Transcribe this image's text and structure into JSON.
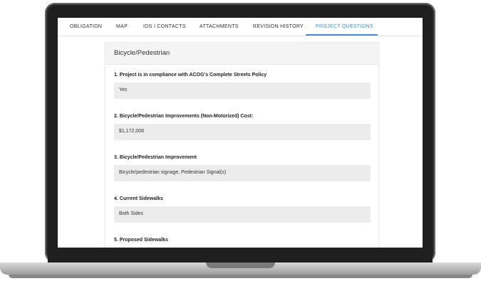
{
  "tabs": [
    {
      "label": "OBLIGATION"
    },
    {
      "label": "MAP"
    },
    {
      "label": "IDS / CONTACTS"
    },
    {
      "label": "ATTACHMENTS"
    },
    {
      "label": "REVISION HISTORY"
    },
    {
      "label": "PROJECT QUESTIONS",
      "active": true
    }
  ],
  "section": {
    "title": "Bicycle/Pedestrian",
    "questions": [
      {
        "label": "1. Project is in compliance with ACOG's Complete Streets Policy",
        "answer": "Yes"
      },
      {
        "label": "2. Bicycle/Pedestrian Improvements (Non-Motorized) Cost:",
        "answer": "$1,172,008"
      },
      {
        "label": "3. Bicycle/Pedestrian Improvement",
        "answer": "Bicycle/pedestrian signage, Pedestrian Signal(s)"
      },
      {
        "label": "4. Current Sidewalks",
        "answer": "Both Sides"
      },
      {
        "label": "5. Proposed Sidewalks",
        "answer": ""
      }
    ]
  },
  "colors": {
    "accent": "#4a90d9",
    "answer_bg": "#ececec",
    "header_bg": "#f4f4f4"
  }
}
